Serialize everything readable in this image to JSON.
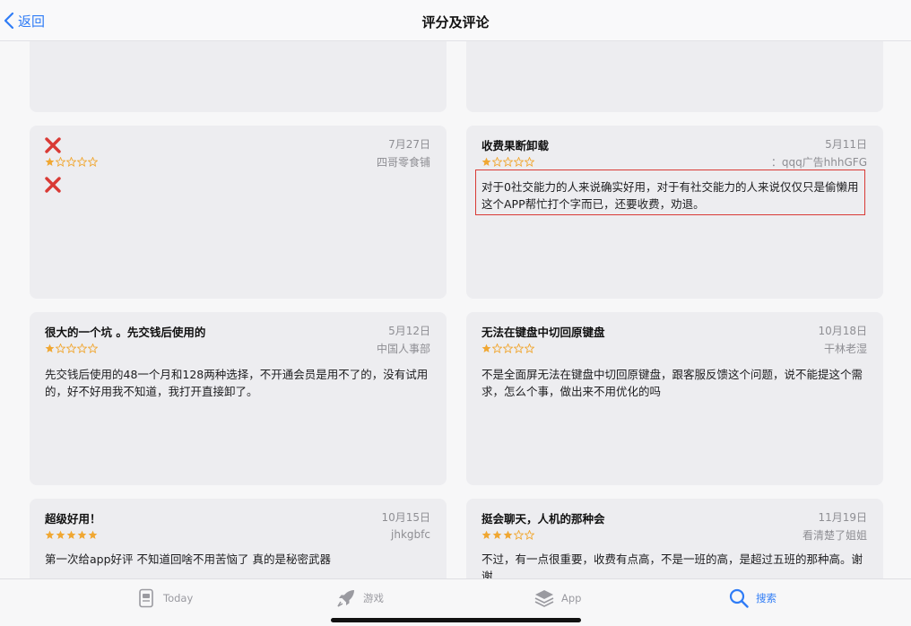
{
  "nav": {
    "back_label": "返回",
    "title": "评分及评论"
  },
  "colors": {
    "accent": "#2f7cf6",
    "star": "#f0a732",
    "highlight": "#d93a35",
    "reject": "#d93a35"
  },
  "reviews": [
    {
      "title": "",
      "date": "7月27日",
      "author": "四哥零食铺",
      "rating": 1,
      "body": "",
      "icons": [
        "x-icon",
        "x-icon"
      ]
    },
    {
      "title": "收费果断卸载",
      "date": "5月11日",
      "author": "：qqq广告hhhGFG",
      "rating": 1,
      "body": "对于0社交能力的人来说确实好用，对于有社交能力的人来说仅仅只是偷懒用这个APP帮忙打个字而已，还要收费，劝退。"
    },
    {
      "title": "很大的一个坑 。先交钱后使用的",
      "date": "5月12日",
      "author": "中国人事部",
      "rating": 1,
      "body": "先交钱后使用的48一个月和128两种选择，不开通会员是用不了的，没有试用的，好不好用我不知道，我打开直接卸了。"
    },
    {
      "title": "无法在键盘中切回原键盘",
      "date": "10月18日",
      "author": "干林老湿",
      "rating": 1,
      "body": "不是全面屏无法在键盘中切回原键盘，跟客服反馈这个问题，说不能提这个需求，怎么个事，做出来不用优化的吗"
    },
    {
      "title": "超级好用！",
      "date": "10月15日",
      "author": "jhkgbfc",
      "rating": 5,
      "body": "第一次给app好评 不知道回啥不用苦恼了 真的是秘密武器"
    },
    {
      "title": "挺会聊天，人机的那种会",
      "date": "11月19日",
      "author": "看清楚了姐姐",
      "rating": 3,
      "body": "不过，有一点很重要，收费有点高，不是一班的高，是超过五班的那种高。谢谢"
    }
  ],
  "tabs": [
    {
      "label": "Today",
      "icon": "today-icon",
      "active": false
    },
    {
      "label": "游戏",
      "icon": "rocket-icon",
      "active": false
    },
    {
      "label": "App",
      "icon": "apps-stack-icon",
      "active": false
    },
    {
      "label": "搜索",
      "icon": "search-icon",
      "active": true
    }
  ]
}
